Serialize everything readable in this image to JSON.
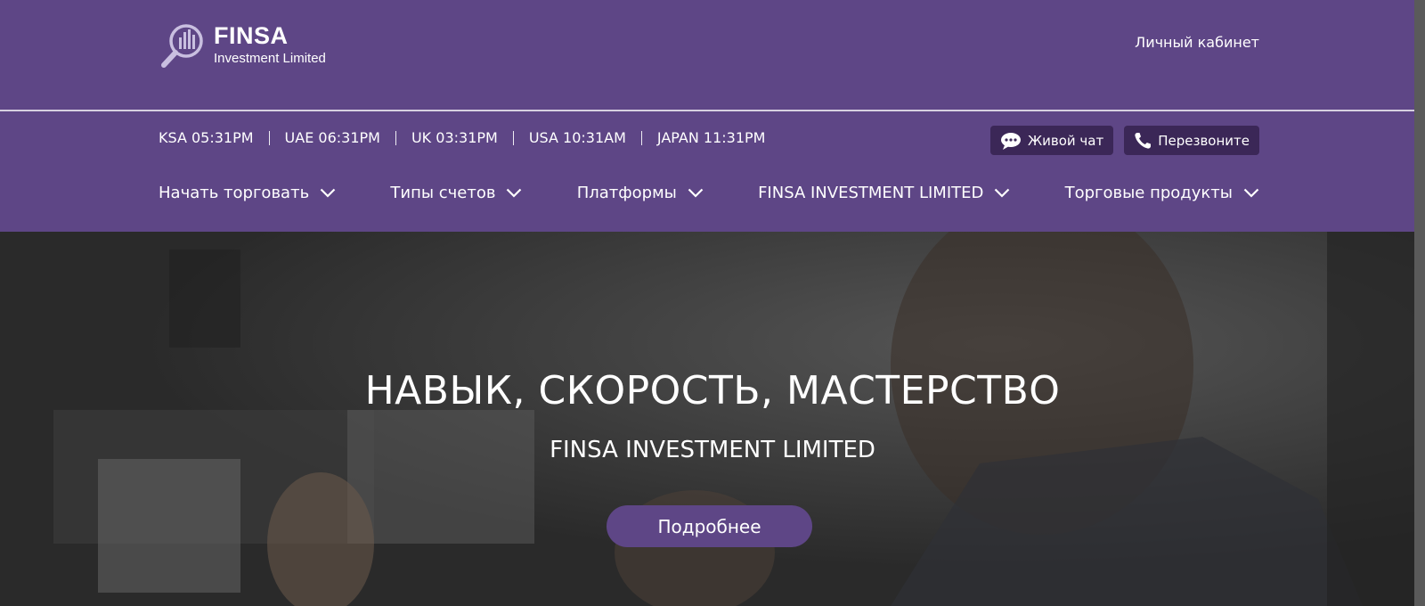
{
  "brand": {
    "name": "FINSA",
    "tagline": "Investment Limited",
    "logo_icon": "magnifier-chart-icon"
  },
  "header": {
    "account_link": "Личный кабинет"
  },
  "clocks": [
    {
      "label": "KSA 05:31PM"
    },
    {
      "label": "UAE 06:31PM"
    },
    {
      "label": "UK 03:31PM"
    },
    {
      "label": "USA 10:31AM"
    },
    {
      "label": "JAPAN 11:31PM"
    }
  ],
  "actions": {
    "live_chat": "Живой чат",
    "callback": "Перезвоните"
  },
  "nav": [
    {
      "label": "Начать торговать"
    },
    {
      "label": "Типы счетов"
    },
    {
      "label": "Платформы"
    },
    {
      "label": "FINSA INVESTMENT LIMITED"
    },
    {
      "label": "Торговые продукты"
    }
  ],
  "hero": {
    "title": "НАВЫК, СКОРОСТЬ, МАСТЕРСТВО",
    "subtitle": "FINSA INVESTMENT LIMITED",
    "button": "Подробнее"
  },
  "colors": {
    "brand_purple": "#5e4686",
    "dark_button": "#3b2757",
    "divider": "#d6d0e0"
  }
}
